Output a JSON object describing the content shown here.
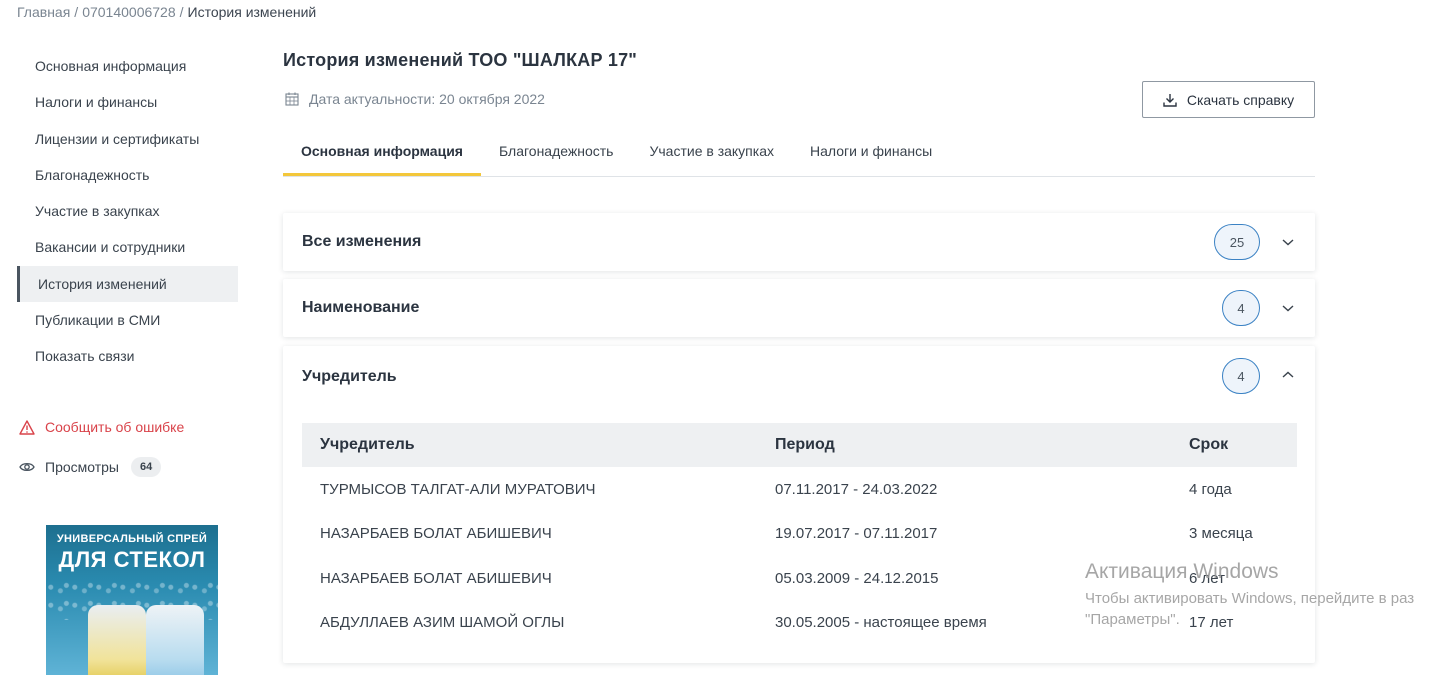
{
  "breadcrumb": {
    "home": "Главная",
    "bin": "070140006728",
    "current": "История изменений"
  },
  "sidebar": {
    "items": [
      {
        "label": "Основная информация",
        "active": false
      },
      {
        "label": "Налоги и финансы",
        "active": false
      },
      {
        "label": "Лицензии и сертификаты",
        "active": false
      },
      {
        "label": "Благонадежность",
        "active": false
      },
      {
        "label": "Участие в закупках",
        "active": false
      },
      {
        "label": "Вакансии и сотрудники",
        "active": false
      },
      {
        "label": "История изменений",
        "active": true
      },
      {
        "label": "Публикации в СМИ",
        "active": false
      },
      {
        "label": "Показать связи",
        "active": false
      }
    ],
    "report_error": "Сообщить об ошибке",
    "views_label": "Просмотры",
    "views_count": "64"
  },
  "ad": {
    "line1": "УНИВЕРСАЛЬНЫЙ СПРЕЙ",
    "line2": "ДЛЯ СТЕКОЛ"
  },
  "main": {
    "title": "История изменений ТОО \"ШАЛКАР 17\"",
    "date_text": "Дата актуальности: 20 октября 2022",
    "download_label": "Скачать справку",
    "tabs": [
      {
        "label": "Основная информация",
        "active": true
      },
      {
        "label": "Благонадежность",
        "active": false
      },
      {
        "label": "Участие в закупках",
        "active": false
      },
      {
        "label": "Налоги и финансы",
        "active": false
      }
    ],
    "sections": [
      {
        "title": "Все изменения",
        "count": "25",
        "expanded": false
      },
      {
        "title": "Наименование",
        "count": "4",
        "expanded": false
      },
      {
        "title": "Учредитель",
        "count": "4",
        "expanded": true
      }
    ],
    "founders_table": {
      "headers": [
        "Учредитель",
        "Период",
        "Срок"
      ],
      "rows": [
        [
          "ТУРМЫСОВ ТАЛГАТ-АЛИ МУРАТОВИЧ",
          "07.11.2017 - 24.03.2022",
          "4 года"
        ],
        [
          "НАЗАРБАЕВ БОЛАТ АБИШЕВИЧ",
          "19.07.2017 - 07.11.2017",
          "3 месяца"
        ],
        [
          "НАЗАРБАЕВ БОЛАТ АБИШЕВИЧ",
          "05.03.2009 - 24.12.2015",
          "6 лет"
        ],
        [
          "АБДУЛЛАЕВ АЗИМ ШАМОЙ ОГЛЫ",
          "30.05.2005 - настоящее время",
          "17 лет"
        ]
      ]
    }
  },
  "watermark": {
    "line1": "Активация Windows",
    "line2": "Чтобы активировать Windows, перейдите в раз",
    "line3": "\"Параметры\"."
  },
  "colors": {
    "accent_tab": "#f3c73b",
    "error": "#d9434a",
    "count_border": "#3b82c4"
  }
}
